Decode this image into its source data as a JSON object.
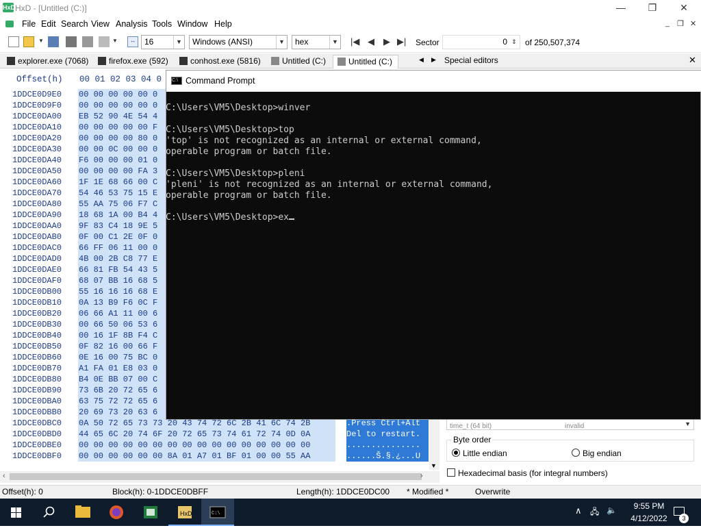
{
  "titlebar": {
    "title": "HxD - [Untitled (C:)]",
    "app_icon_text": "HxD"
  },
  "menu": {
    "items": [
      "File",
      "Edit",
      "Search",
      "View",
      "Analysis",
      "Tools",
      "Window",
      "Help"
    ]
  },
  "toolbar": {
    "bytes_per_row": "16",
    "charset": "Windows (ANSI)",
    "display_mode": "hex",
    "sector_label": "Sector",
    "sector_value": "0",
    "sector_total": "of 250,507,374"
  },
  "tabs": [
    {
      "label": "explorer.exe (7068)"
    },
    {
      "label": "firefox.exe (592)"
    },
    {
      "label": "conhost.exe (5816)"
    },
    {
      "label": "Untitled (C:)"
    },
    {
      "label": "Untitled (C:)",
      "active": true
    }
  ],
  "special_editors": "Special editors",
  "hex": {
    "offset_header": "Offset(h)",
    "col_header": "00 01 02 03 04 0",
    "rows": [
      {
        "off": "1DDCE0D9E0",
        "bytes": "00 00 00 00 00 0"
      },
      {
        "off": "1DDCE0D9F0",
        "bytes": "00 00 00 00 00 0"
      },
      {
        "off": "1DDCE0DA00",
        "bytes": "EB 52 90 4E 54 4"
      },
      {
        "off": "1DDCE0DA10",
        "bytes": "00 00 00 00 00 F"
      },
      {
        "off": "1DDCE0DA20",
        "bytes": "00 00 00 00 80 0"
      },
      {
        "off": "1DDCE0DA30",
        "bytes": "00 00 0C 00 00 0"
      },
      {
        "off": "1DDCE0DA40",
        "bytes": "F6 00 00 00 01 0"
      },
      {
        "off": "1DDCE0DA50",
        "bytes": "00 00 00 00 FA 3"
      },
      {
        "off": "1DDCE0DA60",
        "bytes": "1F 1E 68 66 00 C"
      },
      {
        "off": "1DDCE0DA70",
        "bytes": "54 46 53 75 15 E"
      },
      {
        "off": "1DDCE0DA80",
        "bytes": "55 AA 75 06 F7 C"
      },
      {
        "off": "1DDCE0DA90",
        "bytes": "18 68 1A 00 B4 4"
      },
      {
        "off": "1DDCE0DAA0",
        "bytes": "9F 83 C4 18 9E 5"
      },
      {
        "off": "1DDCE0DAB0",
        "bytes": "0F 00 C1 2E 0F 0"
      },
      {
        "off": "1DDCE0DAC0",
        "bytes": "66 FF 06 11 00 0"
      },
      {
        "off": "1DDCE0DAD0",
        "bytes": "4B 00 2B C8 77 E"
      },
      {
        "off": "1DDCE0DAE0",
        "bytes": "66 81 FB 54 43 5"
      },
      {
        "off": "1DDCE0DAF0",
        "bytes": "68 07 BB 16 68 5"
      },
      {
        "off": "1DDCE0DB00",
        "bytes": "55 16 16 16 68 E"
      },
      {
        "off": "1DDCE0DB10",
        "bytes": "0A 13 B9 F6 0C F"
      },
      {
        "off": "1DDCE0DB20",
        "bytes": "06 66 A1 11 00 6"
      },
      {
        "off": "1DDCE0DB30",
        "bytes": "00 66 50 06 53 6"
      },
      {
        "off": "1DDCE0DB40",
        "bytes": "00 16 1F 8B F4 C"
      },
      {
        "off": "1DDCE0DB50",
        "bytes": "0F 82 16 00 66 F"
      },
      {
        "off": "1DDCE0DB60",
        "bytes": "0E 16 00 75 BC 0"
      },
      {
        "off": "1DDCE0DB70",
        "bytes": "A1 FA 01 E8 03 0"
      },
      {
        "off": "1DDCE0DB80",
        "bytes": "B4 0E BB 07 00 C"
      },
      {
        "off": "1DDCE0DB90",
        "bytes": "73 6B 20 72 65 6"
      },
      {
        "off": "1DDCE0DBA0",
        "bytes": "63 75 72 72 65 6"
      },
      {
        "off": "1DDCE0DBB0",
        "bytes": "20 69 73 20 63 6"
      }
    ],
    "full_rows": [
      {
        "off": "1DDCE0DBC0",
        "bytes": "0A 50 72 65 73 73 20 43 74 72 6C 2B 41 6C 74 2B",
        "text": ".Press Ctrl+Alt"
      },
      {
        "off": "1DDCE0DBD0",
        "bytes": "44 65 6C 20 74 6F 20 72 65 73 74 61 72 74 0D 0A",
        "text": "Del to restart."
      },
      {
        "off": "1DDCE0DBE0",
        "bytes": "00 00 00 00 00 00 00 00 00 00 00 00 00 00 00 00",
        "text": "..............."
      },
      {
        "off": "1DDCE0DBF0",
        "bytes": "00 00 00 00 00 00 8A 01 A7 01 BF 01 00 00 55 AA",
        "text": "......Š.§.¿...U"
      }
    ]
  },
  "inspector": {
    "byte_order_label": "Byte order",
    "little_endian": "Little endian",
    "big_endian": "Big endian",
    "hex_basis": "Hexadecimal basis (for integral numbers)",
    "cut_row_left": "time_t (64 bit)",
    "cut_row_right": "invalid"
  },
  "status": {
    "offset": "Offset(h): 0",
    "block": "Block(h): 0-1DDCE0DBFF",
    "length": "Length(h): 1DDCE0DC00",
    "modified": "* Modified *",
    "mode": "Overwrite"
  },
  "cmd": {
    "title": "Command Prompt",
    "lines": [
      "C:\\Users\\VM5\\Desktop>winver",
      "",
      "C:\\Users\\VM5\\Desktop>top",
      "'top' is not recognized as an internal or external command,",
      "operable program or batch file.",
      "",
      "C:\\Users\\VM5\\Desktop>pleni",
      "'pleni' is not recognized as an internal or external command,",
      "operable program or batch file.",
      ""
    ],
    "current_input": "C:\\Users\\VM5\\Desktop>ex"
  },
  "taskbar": {
    "time": "9:55 PM",
    "date": "4/12/2022",
    "notif_count": "3"
  }
}
